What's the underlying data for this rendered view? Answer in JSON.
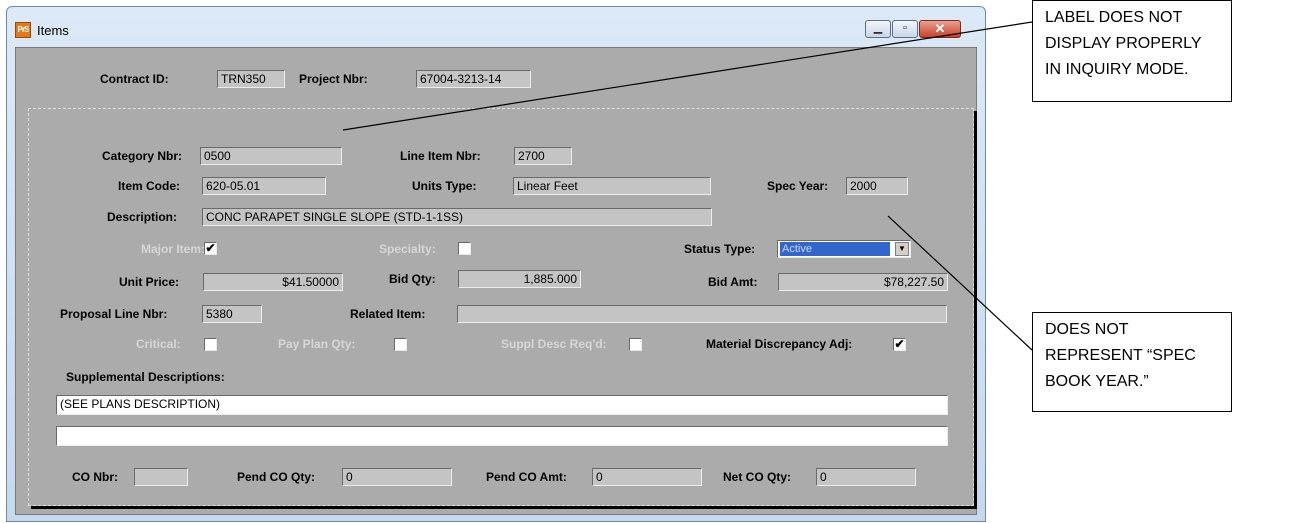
{
  "window": {
    "title": "Items",
    "app_icon_text": "PrS"
  },
  "header": {
    "contract_id_label": "Contract ID:",
    "contract_id": "TRN350",
    "project_nbr_label": "Project Nbr:",
    "project_nbr": "67004-3213-14"
  },
  "form": {
    "category_nbr_label": "Category Nbr:",
    "category_nbr": "0500",
    "line_item_nbr_label": "Line Item Nbr:",
    "line_item_nbr": "2700",
    "item_code_label": "Item Code:",
    "item_code": "620-05.01",
    "units_type_label": "Units Type:",
    "units_type": "Linear Feet",
    "spec_year_label": "Spec Year:",
    "spec_year": "2000",
    "description_label": "Description:",
    "description": "CONC PARAPET SINGLE SLOPE (STD-1-1SS)",
    "major_item_label": "Major Item:",
    "major_item_checked": "✔",
    "specialty_label": "Specialty:",
    "status_type_label": "Status Type:",
    "status_type": "Active",
    "unit_price_label": "Unit Price:",
    "unit_price": "$41.50000",
    "bid_qty_label": "Bid Qty:",
    "bid_qty": "1,885.000",
    "bid_amt_label": "Bid Amt:",
    "bid_amt": "$78,227.50",
    "proposal_line_nbr_label": "Proposal Line Nbr:",
    "proposal_line_nbr": "5380",
    "related_item_label": "Related Item:",
    "related_item": "",
    "critical_label": "Critical:",
    "pay_plan_qty_label": "Pay Plan Qty:",
    "suppl_desc_label": "Suppl Desc Req'd:",
    "material_discrepancy_label": "Material Discrepancy Adj:",
    "material_discrepancy_checked": "✔",
    "supplemental_label": "Supplemental Descriptions:",
    "supplemental_1": "(SEE PLANS DESCRIPTION)",
    "supplemental_2": "",
    "co_nbr_label": "CO Nbr:",
    "co_nbr": "",
    "pend_co_qty_label": "Pend CO Qty:",
    "pend_co_qty": "0",
    "pend_co_amt_label": "Pend CO Amt:",
    "pend_co_amt": "0",
    "net_co_qty_label": "Net CO Qty:",
    "net_co_qty": "0"
  },
  "callouts": {
    "label_issue": [
      "LABEL DOES NOT",
      "DISPLAY PROPERLY",
      "IN INQUIRY MODE."
    ],
    "spec_issue": [
      "DOES NOT",
      "REPRESENT “SPEC",
      "BOOK YEAR.”"
    ]
  }
}
